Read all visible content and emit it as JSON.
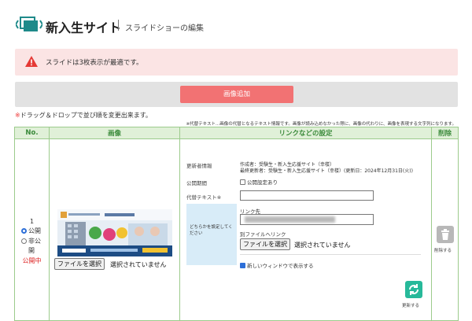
{
  "header": {
    "logo_icon": "slides-stack-icon",
    "title": "新入生サイト",
    "subtitle": "スライドショーの編集"
  },
  "alert": {
    "icon": "warning-triangle-icon",
    "color": "#fbe4e4",
    "message": "スライドは3枚表示が最適です。"
  },
  "toolbar": {
    "add_label": "画像追加",
    "add_color": "#f27273"
  },
  "notes": {
    "drag_mark": "※",
    "drag_text": "ドラッグ＆ドロップで並び順を変更出来ます。",
    "alt_text_note": "※代替テキスト...画像の代替となるテキスト情報です。画像が読み込めなかった際に、画像の代わりに、画像を表現する文字列になります。"
  },
  "table": {
    "headers": {
      "no": "No.",
      "image": "画像",
      "settings": "リンクなどの設定",
      "delete": "削除"
    },
    "header_color": "#e0f0d8",
    "rows": [
      {
        "no": "1",
        "visibility_public": "公開",
        "visibility_private": "非公",
        "visibility_private_tail": "開",
        "visibility_selected": "public",
        "status": "公開中",
        "image": {
          "file_button": "ファイルを選択",
          "file_status": "選択されていません"
        },
        "settings": {
          "updater_label": "更新者情報",
          "creator_line": "作成者：受験生・新入生応援サイト（幸楼）",
          "updater_line": "最終更新者：受験生・新入生応援サイト（幸楼）(更新日：2024年12月31日(火))",
          "period_label": "公開期間",
          "period_checkbox": "公開設定あり",
          "period_checked": false,
          "alt_label": "代替テキスト※",
          "alt_value": "",
          "either_box": "どちらかを設定してください",
          "link_label": "リンク先",
          "file_link_label": "別ファイルへリンク",
          "file_button": "ファイルを選択",
          "file_status": "選択されていません",
          "new_window_label": "新しいウィンドウで表示する",
          "new_window_checked": true,
          "update_label": "更新する",
          "update_icon": "refresh-icon"
        },
        "delete": {
          "label": "削除する",
          "icon": "trash-icon"
        }
      }
    ]
  }
}
